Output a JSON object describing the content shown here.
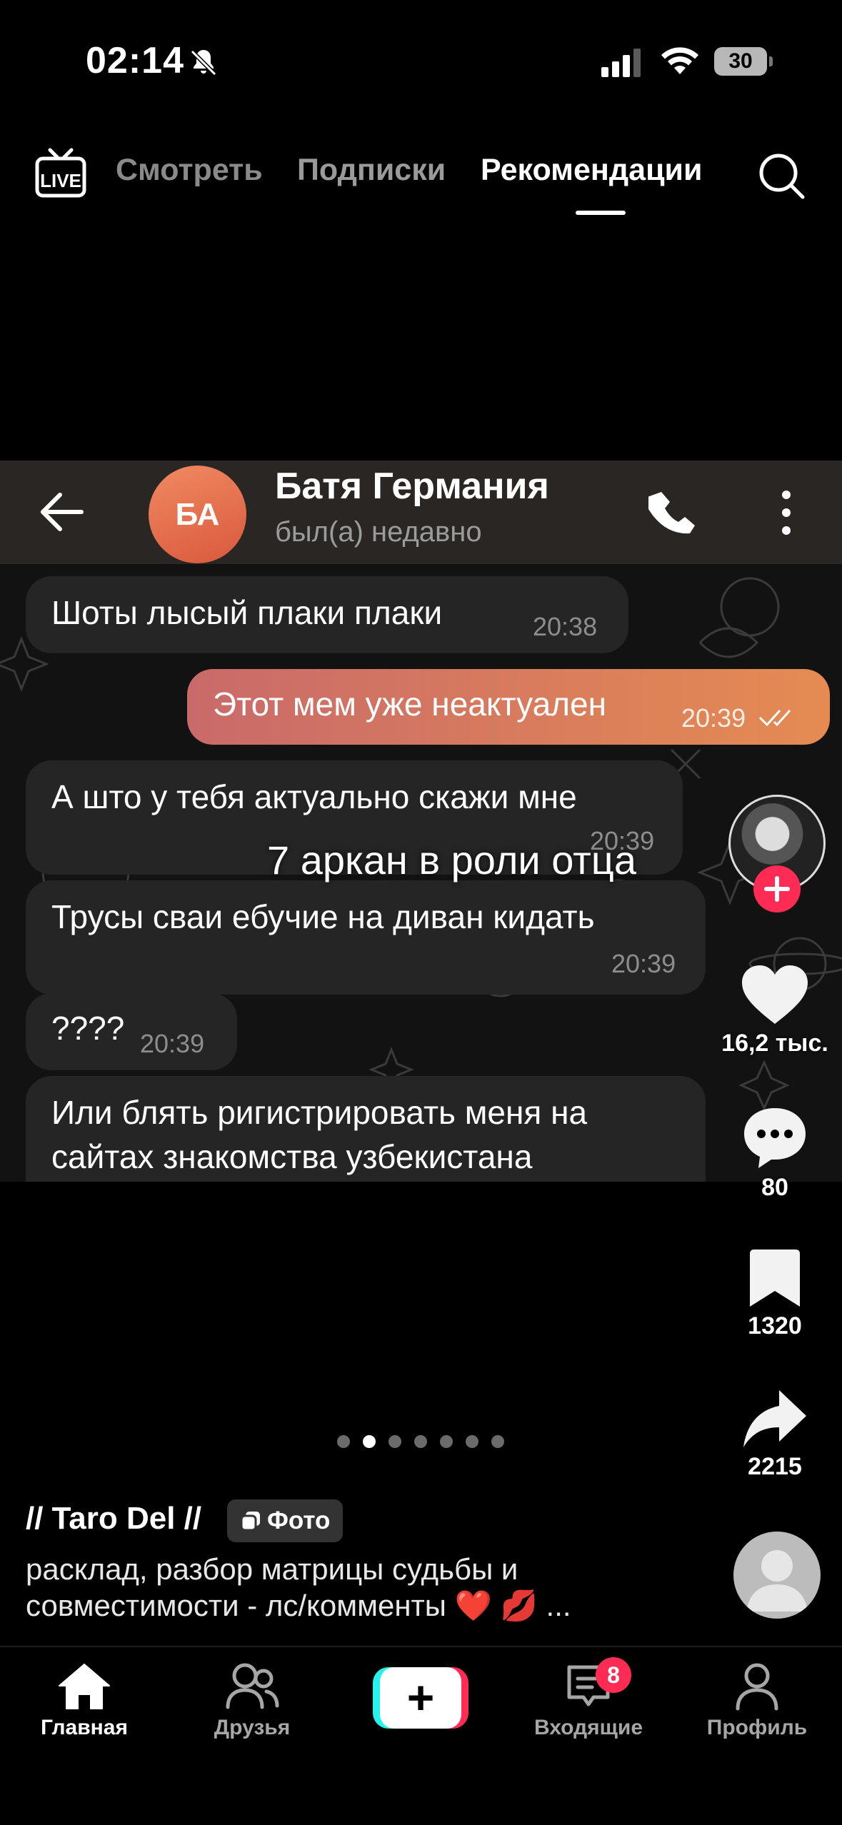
{
  "status_bar": {
    "time": "02:14",
    "battery": "30",
    "icons": [
      "bell-muted-icon",
      "cellular-signal-icon",
      "wifi-icon",
      "battery-icon"
    ]
  },
  "top_nav": {
    "live_label": "LIVE",
    "tabs": [
      {
        "label": "Смотреть",
        "active": false
      },
      {
        "label": "Подписки",
        "active": false
      },
      {
        "label": "Рекомендации",
        "active": true
      }
    ]
  },
  "chat": {
    "contact_initials": "БА",
    "contact_name": "Батя Германия",
    "contact_status": "был(а) недавно",
    "messages": [
      {
        "text": "Шоты лысый плаки плаки",
        "time": "20:38",
        "outgoing": false
      },
      {
        "text": "Этот мем уже неактуален",
        "time": "20:39",
        "outgoing": true
      },
      {
        "text": "А што у тебя актуально скажи мне",
        "time": "20:39",
        "outgoing": false
      },
      {
        "text": "Трусы сваи ебучие на диван кидать",
        "time": "20:39",
        "outgoing": false
      },
      {
        "text": "????",
        "time": "20:39",
        "outgoing": false
      },
      {
        "text_line1": "Или блять ригистрировать меня на",
        "text_line2": "сайтах знакомства узбекистана",
        "outgoing": false
      }
    ]
  },
  "overlay_caption": "7 аркан в роли отца",
  "actions": {
    "likes": "16,2 тыс.",
    "comments": "80",
    "saves": "1320",
    "shares": "2215"
  },
  "carousel": {
    "total": 7,
    "active_index": 1
  },
  "post": {
    "author": "// Taro Del //",
    "badge": "Фото",
    "description_line1": "расклад, разбор матрицы судьбы и",
    "description_line2": "совместимости - лс/комменты ❤️ 💋 ..."
  },
  "bottom_nav": {
    "home": "Главная",
    "friends": "Друзья",
    "inbox": "Входящие",
    "inbox_badge": "8",
    "profile": "Профиль"
  },
  "colors": {
    "accent_red": "#fe2c55",
    "accent_cyan": "#25f4ee",
    "outgoing_bubble": "#e58b52",
    "incoming_bubble": "#252525"
  }
}
